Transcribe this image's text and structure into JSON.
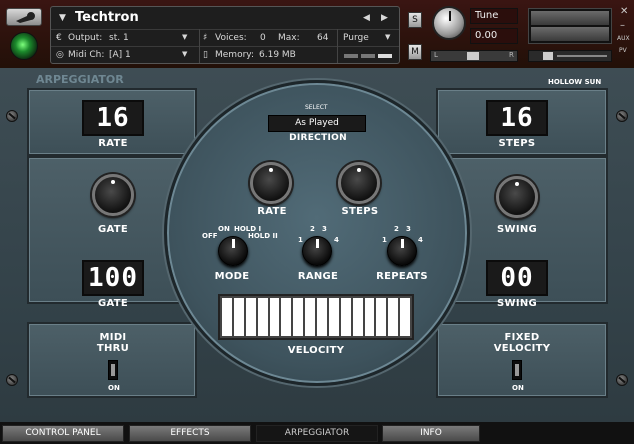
{
  "header": {
    "title": "Techtron",
    "output_label": "Output:",
    "output_value": "st. 1",
    "midi_label": "Midi Ch:",
    "midi_value": "[A] 1",
    "voices_label": "Voices:",
    "voices_value": "0",
    "max_label": "Max:",
    "max_value": "64",
    "purge_label": "Purge",
    "memory_label": "Memory:",
    "memory_value": "6.19 MB",
    "solo_label": "S",
    "mute_label": "M",
    "tune_label": "Tune",
    "tune_value": "0.00",
    "pan_left": "L",
    "pan_right": "R",
    "aux_label": "AUX",
    "pv_label": "PV"
  },
  "arpeggiator": {
    "section_title": "ARPEGGIATOR",
    "brand": "HOLLOW SUN",
    "rate_display": "16",
    "rate_label": "RATE",
    "steps_display": "16",
    "steps_label": "STEPS",
    "gate_label": "GATE",
    "gate_display": "100",
    "gate_display_label": "GATE",
    "swing_label": "SWING",
    "swing_display": "00",
    "swing_display_label": "SWING",
    "midi_thru_label": "MIDI\nTHRU",
    "midi_thru_state": "ON",
    "fixed_velocity_label": "FIXED\nVELOCITY",
    "fixed_velocity_state": "ON",
    "direction_select": "SELECT",
    "direction_value": "As Played",
    "direction_label": "DIRECTION",
    "knob_rate_label": "RATE",
    "knob_steps_label": "STEPS",
    "mode_label": "MODE",
    "mode_opt_off": "OFF",
    "mode_opt_on": "ON",
    "mode_opt_hold1": "HOLD I",
    "mode_opt_hold2": "HOLD II",
    "range_label": "RANGE",
    "repeats_label": "REPEATS",
    "scale_1": "1",
    "scale_2": "2",
    "scale_3": "3",
    "scale_4": "4",
    "velocity_label": "VELOCITY",
    "velocity_steps": 16
  },
  "tabs": [
    {
      "label": "CONTROL PANEL"
    },
    {
      "label": "EFFECTS"
    },
    {
      "label": "ARPEGGIATOR"
    },
    {
      "label": "INFO"
    }
  ],
  "active_tab": "ARPEGGIATOR"
}
